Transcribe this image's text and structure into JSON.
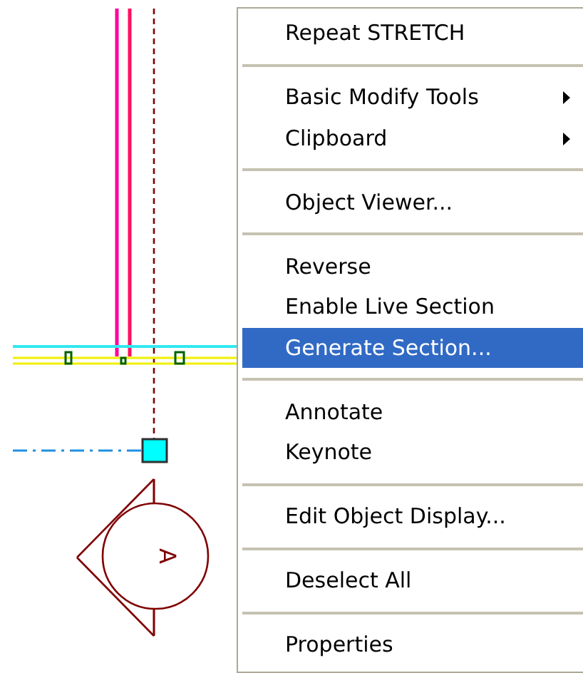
{
  "drawing": {
    "section_marker": {
      "label": "A"
    }
  },
  "context_menu": {
    "items": [
      {
        "kind": "item",
        "label": "Repeat STRETCH",
        "submenu": false,
        "selected": false
      },
      {
        "kind": "separator"
      },
      {
        "kind": "item",
        "label": "Basic Modify Tools",
        "submenu": true,
        "selected": false
      },
      {
        "kind": "item",
        "label": "Clipboard",
        "submenu": true,
        "selected": false
      },
      {
        "kind": "separator"
      },
      {
        "kind": "item",
        "label": "Object Viewer...",
        "submenu": false,
        "selected": false
      },
      {
        "kind": "separator"
      },
      {
        "kind": "item",
        "label": "Reverse",
        "submenu": false,
        "selected": false
      },
      {
        "kind": "item",
        "label": "Enable Live Section",
        "submenu": false,
        "selected": false
      },
      {
        "kind": "item",
        "label": "Generate Section...",
        "submenu": false,
        "selected": true
      },
      {
        "kind": "separator"
      },
      {
        "kind": "item",
        "label": "Annotate",
        "submenu": false,
        "selected": false
      },
      {
        "kind": "item",
        "label": "Keynote",
        "submenu": false,
        "selected": false
      },
      {
        "kind": "separator"
      },
      {
        "kind": "item",
        "label": "Edit Object Display...",
        "submenu": false,
        "selected": false
      },
      {
        "kind": "separator"
      },
      {
        "kind": "item",
        "label": "Deselect All",
        "submenu": false,
        "selected": false
      },
      {
        "kind": "separator"
      },
      {
        "kind": "item",
        "label": "Properties",
        "submenu": false,
        "selected": false
      }
    ]
  }
}
